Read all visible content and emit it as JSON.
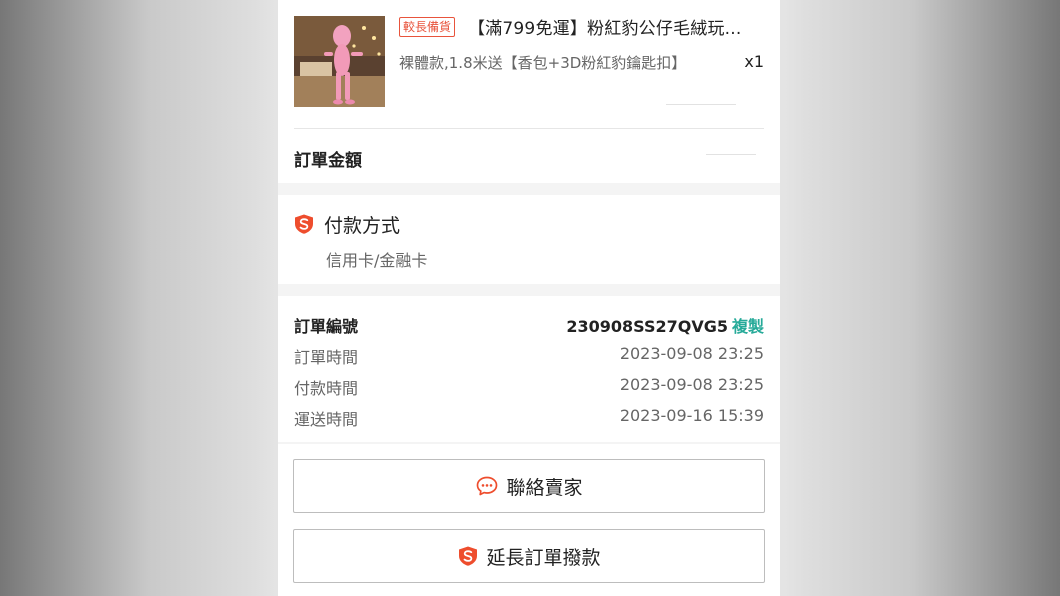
{
  "product": {
    "tag": "較長備貨",
    "title": "【滿799免運】粉紅豹公仔毛絨玩...",
    "variant": "裸體款,1.8米送【香包+3D粉紅豹鑰匙扣】",
    "quantity": "x1"
  },
  "order_total": {
    "label": "訂單金額"
  },
  "payment": {
    "title": "付款方式",
    "method": "信用卡/金融卡",
    "icon": "shield-s-icon"
  },
  "order_info": {
    "order_no_label": "訂單編號",
    "order_no": "230908SS27QVG5",
    "copy_label": "複製",
    "order_time_label": "訂單時間",
    "order_time": "2023-09-08 23:25",
    "pay_time_label": "付款時間",
    "pay_time": "2023-09-08 23:25",
    "ship_time_label": "運送時間",
    "ship_time": "2023-09-16 15:39"
  },
  "actions": {
    "contact_seller": "聯絡賣家",
    "extend_order": "延長訂單撥款"
  },
  "colors": {
    "accent_orange": "#ee4d2d",
    "teal": "#26aa99",
    "tag_red": "#e8543c"
  }
}
